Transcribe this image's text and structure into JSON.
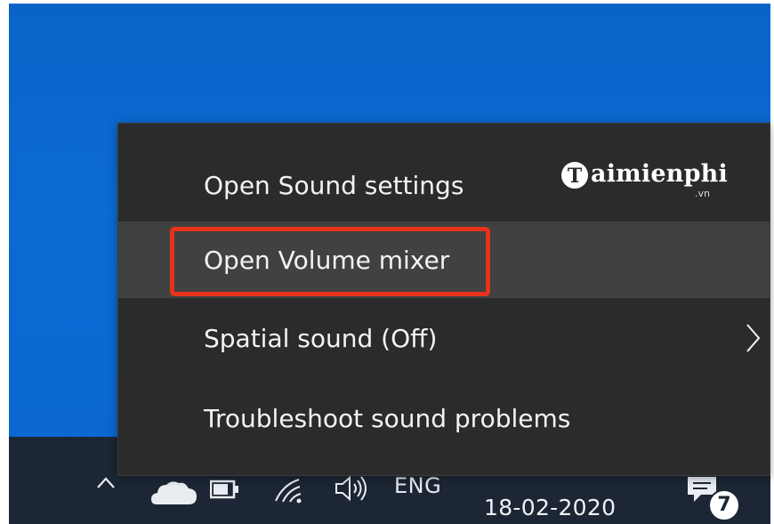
{
  "context_menu": {
    "items": [
      {
        "label": "Open Sound settings",
        "has_submenu": false,
        "state": "normal"
      },
      {
        "label": "Open Volume mixer",
        "has_submenu": false,
        "state": "hovered",
        "highlighted": true
      },
      {
        "label": "Spatial sound (Off)",
        "has_submenu": true,
        "state": "normal"
      },
      {
        "label": "Troubleshoot sound problems",
        "has_submenu": false,
        "state": "normal"
      }
    ],
    "submenu_arrow_icon": "chevron-right-icon",
    "highlight_color": "#e8321b"
  },
  "watermark": {
    "brand_initial": "T",
    "brand_text": "aimienphi",
    "domain": ".vn"
  },
  "taskbar": {
    "tray_icons": [
      "chevron-up-icon",
      "cloud-icon",
      "battery-icon",
      "wifi-icon",
      "speaker-icon"
    ],
    "language": "ENG",
    "date": "18-02-2020",
    "notification_count": "7",
    "notification_icon": "action-center-icon"
  },
  "colors": {
    "desktop_background": "#0b6bd3",
    "taskbar_background": "#1c2634",
    "menu_background": "#2b2b2b",
    "menu_hover": "#414141",
    "menu_text": "#f3f3f3"
  }
}
